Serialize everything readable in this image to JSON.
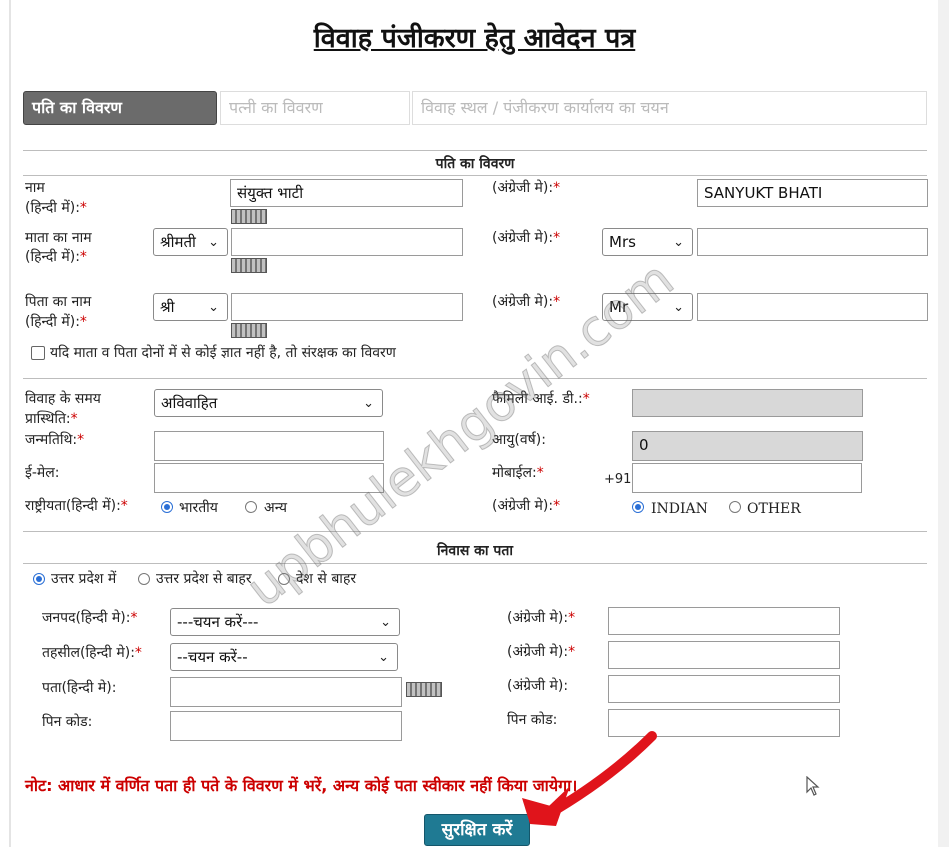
{
  "page": {
    "title": "विवाह पंजीकरण हेतु आवेदन पत्र"
  },
  "tabs": [
    {
      "label": "पति का विवरण"
    },
    {
      "label": "पत्नी का विवरण"
    },
    {
      "label": "विवाह स्थल / पंजीकरण कार्यालय का चयन"
    }
  ],
  "section1": {
    "heading": "पति का विवरण",
    "name_label_1": "नाम",
    "name_label_2": "(हिन्दी में):",
    "name_hi": "संयुक्त भाटी",
    "english_label": "(अंग्रेजी मे):",
    "name_en": "SANYUKT BHATI",
    "mother_label_1": "माता का नाम",
    "mother_label_2": "(हिन्दी में):",
    "mother_title_hi": "श्रीमती",
    "mother_title_en": "Mrs",
    "father_label_1": "पिता का नाम",
    "father_label_2": "(हिन्दी में):",
    "father_title_hi": "श्री",
    "father_title_en": "Mr",
    "guardian_checkbox": "यदि माता व पिता दोनों में से कोई ज्ञात नहीं है, तो संरक्षक का विवरण"
  },
  "section2": {
    "marital_label_1": "विवाह के समय",
    "marital_label_2": "प्रास्थिति:",
    "marital_value": "अविवाहित",
    "family_id_label": "फैमिली आई. डी.:",
    "dob_label": "जन्मतिथि:",
    "age_label": "आयु(वर्ष):",
    "age_value": "0",
    "email_label": "ई-मेल:",
    "mobile_label": "मोबाईल:",
    "mobile_prefix": "+91",
    "nationality_label": "राष्ट्रीयता(हिन्दी में):",
    "nat_hi_opt1": "भारतीय",
    "nat_hi_opt2": "अन्य",
    "nat_en_label": "(अंग्रेजी मे):",
    "nat_en_opt1": "INDIAN",
    "nat_en_opt2": "OTHER"
  },
  "address": {
    "heading": "निवास का पता",
    "opt1": "उत्तर प्रदेश में",
    "opt2": "उत्तर प्रदेश से बाहर",
    "opt3": "देश से बाहर",
    "district_label": "जनपद(हिन्दी मे):",
    "district_value": "---चयन करें---",
    "tehsil_label": "तहसील(हिन्दी मे):",
    "tehsil_value": "--चयन करें--",
    "address_label": "पता(हिन्दी मे):",
    "pin_label": "पिन कोड:",
    "english_label_1": "(अंग्रेजी मे):",
    "english_label_2": "(अंग्रेजी मे):",
    "english_label_3": "(अंग्रेजी मे):",
    "pin_label_en": "पिन कोड:"
  },
  "note": "नोट:  आधार में वर्णित पता ही पते के विवरण में भरें, अन्य कोई पता स्वीकार नहीं किया जायेगा।",
  "submit_label": "सुरक्षित करें",
  "watermark": "upbhulekhgovin.com",
  "colors": {
    "tab_active_bg": "#6b6b6b",
    "required": "#cc0000",
    "note": "#cc0000",
    "button": "#1f7a93",
    "arrow": "#e0141b",
    "radio": "#2a6fd6"
  }
}
